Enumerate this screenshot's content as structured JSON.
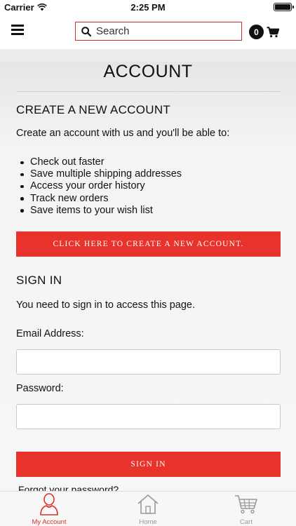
{
  "status_bar": {
    "carrier": "Carrier",
    "time": "2:25 PM"
  },
  "header": {
    "search_placeholder": "Search",
    "cart_count": "0"
  },
  "account": {
    "title": "ACCOUNT",
    "create": {
      "heading": "CREATE A NEW ACCOUNT",
      "intro": "Create an account with us and you'll be able to:",
      "benefits": [
        "Check out faster",
        "Save multiple shipping addresses",
        "Access your order history",
        "Track new orders",
        "Save items to your wish list"
      ],
      "button_label": "CLICK HERE TO CREATE A NEW ACCOUNT."
    },
    "sign_in": {
      "heading": "SIGN IN",
      "message": "You need to sign in to access this page.",
      "email_label": "Email Address:",
      "password_label": "Password:",
      "button_label": "SIGN IN",
      "forgot_label": "Forgot your password?"
    }
  },
  "tab_bar": {
    "items": [
      {
        "label": "My Account",
        "icon": "person-icon",
        "active": true
      },
      {
        "label": "Home",
        "icon": "home-icon",
        "active": false
      },
      {
        "label": "Cart",
        "icon": "cart-icon",
        "active": false
      }
    ]
  },
  "colors": {
    "accent": "#e8332c",
    "search_border": "#c9302c",
    "active_tab": "#d9322b"
  }
}
